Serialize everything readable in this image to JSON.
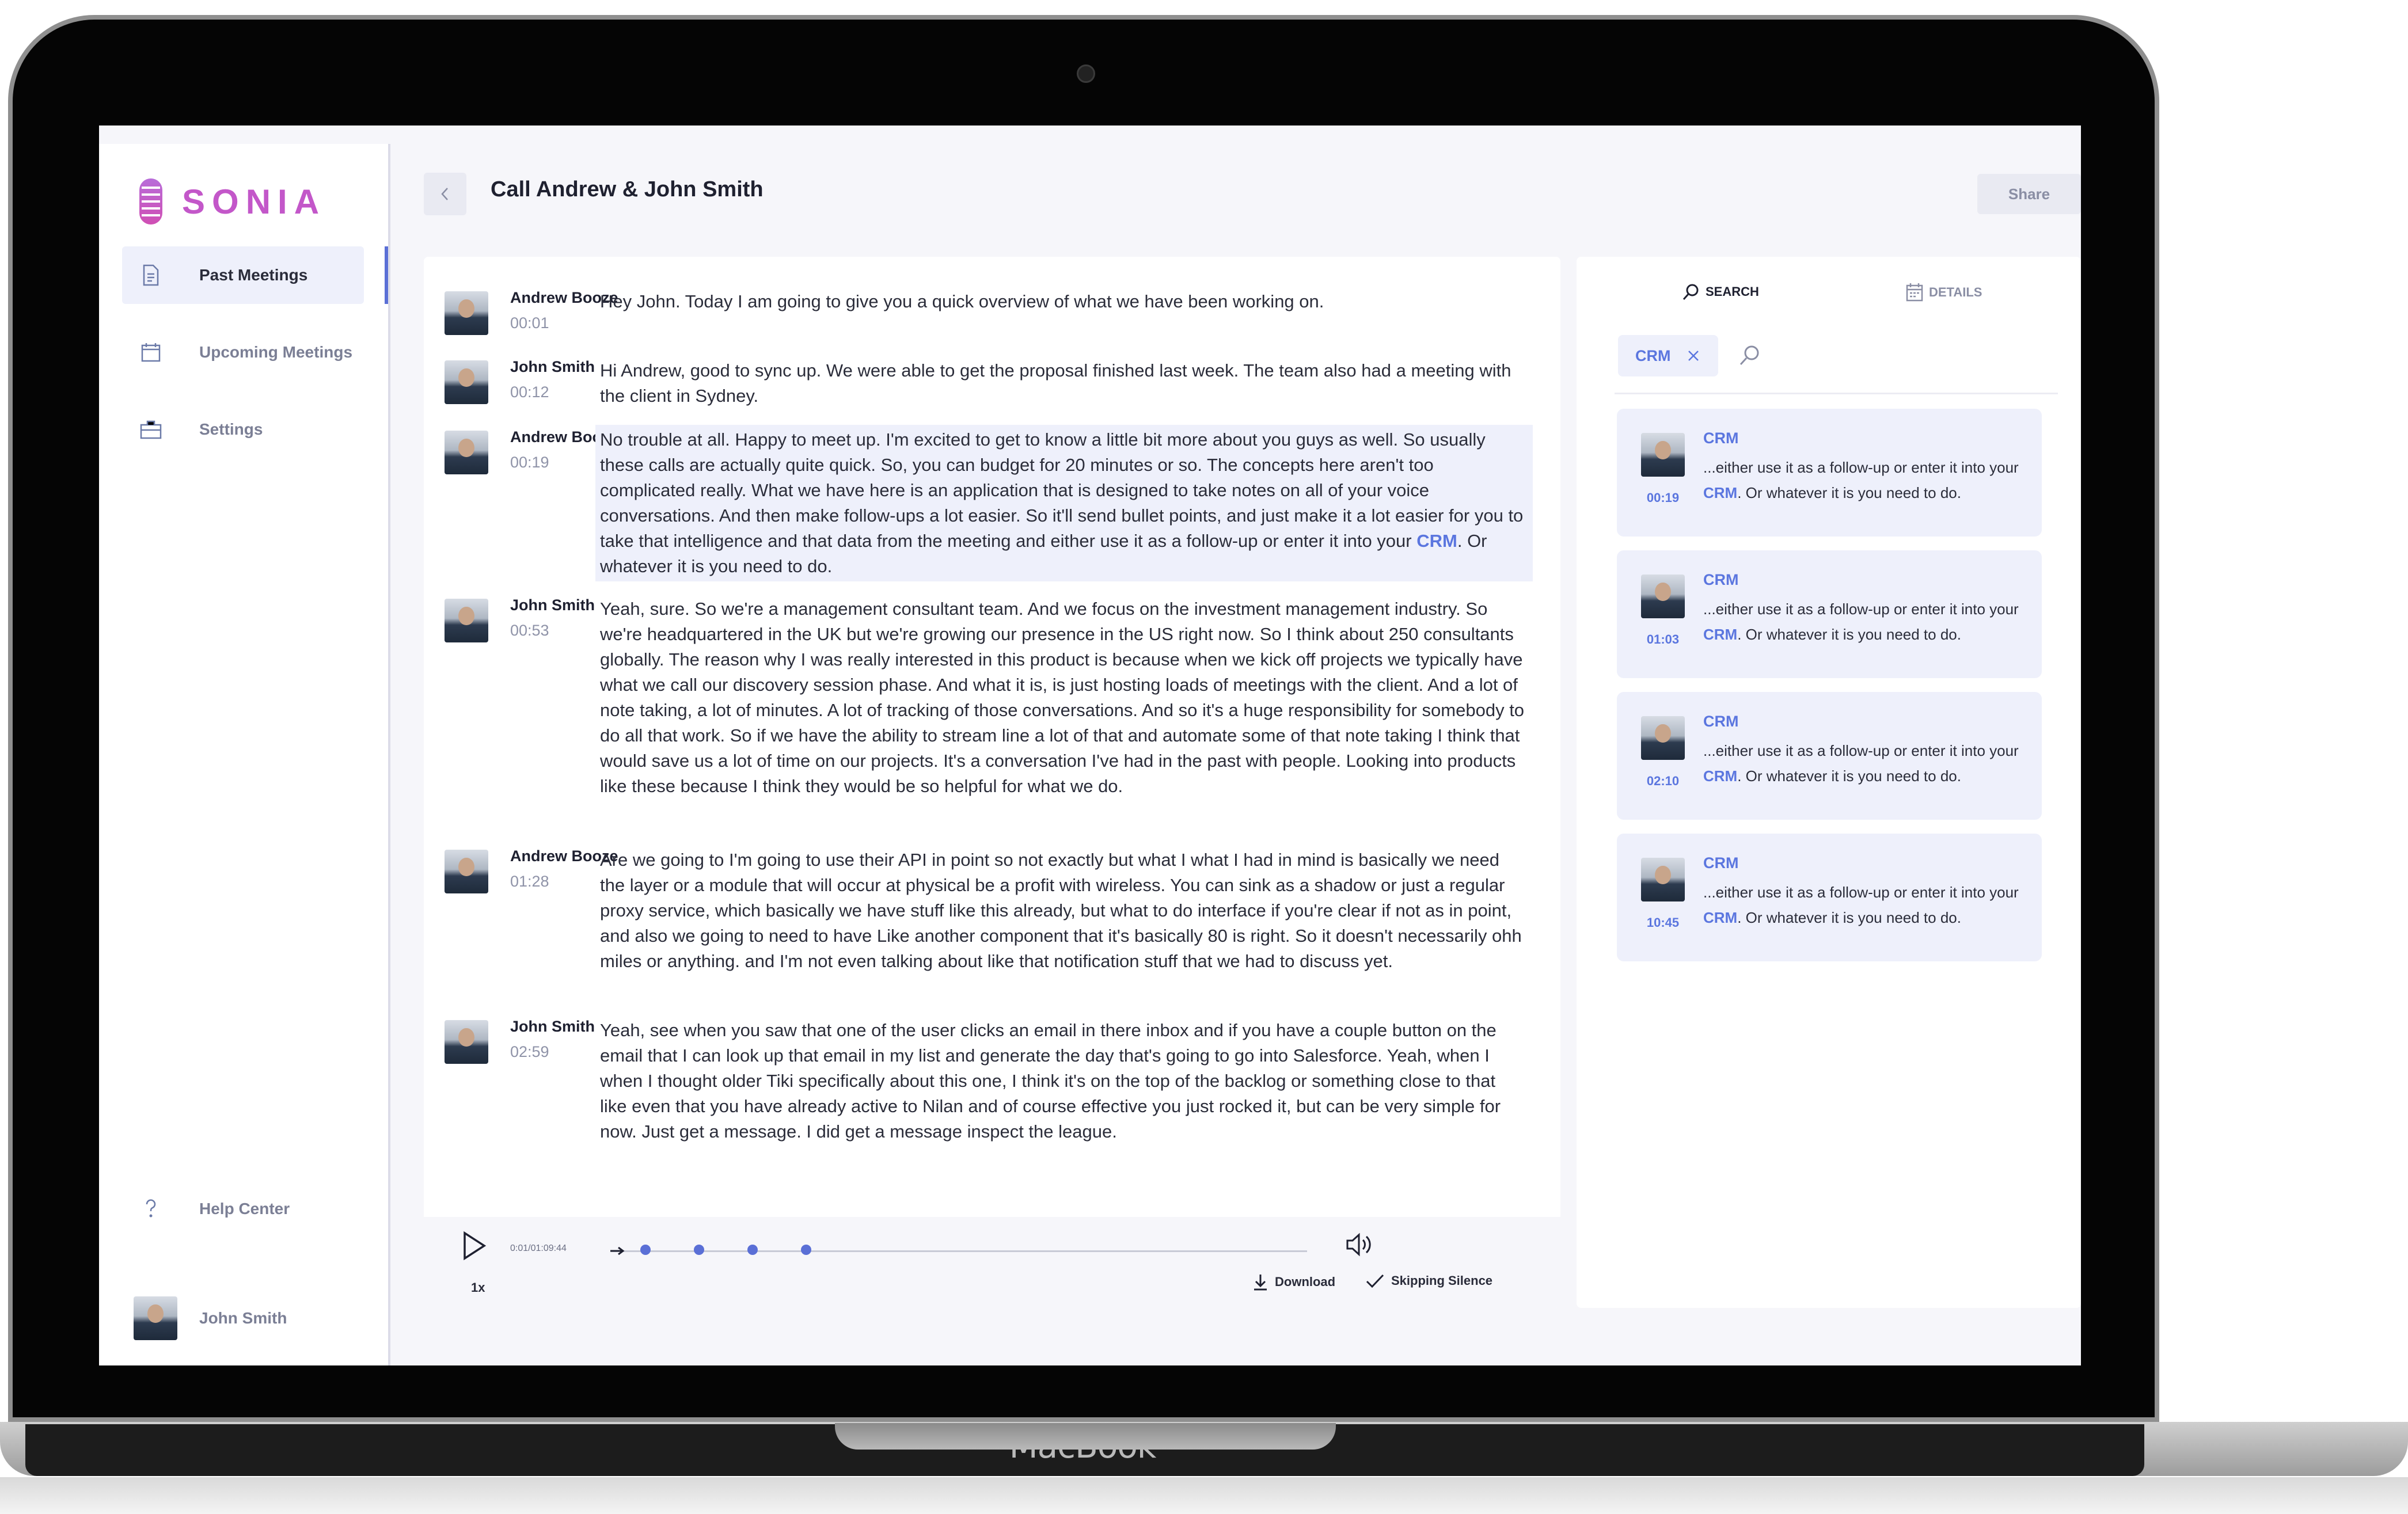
{
  "device": {
    "brand_label": "MacBook"
  },
  "sidebar": {
    "brand": "SONIA",
    "items": [
      {
        "label": "Past Meetings",
        "icon": "document-icon",
        "active": true
      },
      {
        "label": "Upcoming Meetings",
        "icon": "calendar-icon",
        "active": false
      },
      {
        "label": "Settings",
        "icon": "briefcase-icon",
        "active": false
      }
    ],
    "help": {
      "label": "Help Center",
      "icon": "question-icon"
    },
    "user": {
      "name": "John Smith"
    }
  },
  "header": {
    "title": "Call Andrew & John Smith",
    "share_label": "Share"
  },
  "transcript": [
    {
      "speaker": "Andrew Booze",
      "time": "00:01",
      "text": "Hey John. Today I am going to give you a quick overview of what we have been working on."
    },
    {
      "speaker": "John Smith",
      "time": "00:12",
      "text": "Hi Andrew, good to sync up. We were able to get the proposal finished last week. The team also had a meeting with the client in Sydney."
    },
    {
      "speaker": "Andrew Booze",
      "time": "00:19",
      "text_before": "No trouble at all. Happy to meet up. I'm excited to get to know a little bit more about you guys as well. So usually these calls are actually quite quick. So, you can budget for 20 minutes or so. The concepts here aren't too complicated really. What we have here is an application that is designed to take notes on all of your voice conversations. And then make follow-ups a lot easier. So it'll send bullet points, and just make it a lot easier for you to take that intelligence and that data from the meeting and either use it as a follow-up or enter it into your ",
      "keyword": "CRM",
      "text_after": ". Or whatever it is you need to do.",
      "highlighted": true
    },
    {
      "speaker": "John Smith",
      "time": "00:53",
      "text": "Yeah, sure. So we're a management consultant team. And we focus on the investment management industry. So we're headquartered in the UK but we're growing our presence in the US right now. So I think about 250 consultants globally. The reason why I was really interested in this product is because when we kick off projects we typically have what we call our discovery session phase. And what it is, is just hosting loads of meetings with the client. And a lot of note taking, a lot of minutes. A lot of tracking of those conversations. And so it's a huge responsibility for somebody to do all that work. So if we have the ability to stream line a lot of that and automate some of that note taking I think that would save us a lot of time on our projects. It's a conversation I've had in the past with people. Looking into products like these because I think they would be so helpful for what we do."
    },
    {
      "speaker": "Andrew Booze",
      "time": "01:28",
      "text": "Are we going to I'm going to use their API in point so not exactly but what I what I had in mind is basically we need the layer or a module that will occur at physical be a profit with wireless. You can sink as a shadow or just a regular proxy service, which basically we have stuff like this already, but what to do interface if you're clear if not as in point, and also we going to need to have Like another component that it's basically 80 is right. So it doesn't necessarily ohh miles or anything. and I'm not even talking about like that notification stuff that we had to discuss yet."
    },
    {
      "speaker": "John Smith",
      "time": "02:59",
      "text": "Yeah, see when you saw that one of the user clicks an email in there inbox and if you have a couple button on the email that I can look up that email in my list and generate the day that's going to go into Salesforce. Yeah, when I when I thought older Tiki specifically about this one, I think it's on the top of the backlog or something close to that like even that you have already active to Nilan and of course effective you just rocked it, but can be very simple for now. Just get a message. I did get a message inspect the league."
    }
  ],
  "player": {
    "speed": "1x",
    "timestamp": "0:01/01:09:44",
    "markers_fraction": [
      0.05,
      0.127,
      0.204,
      0.281
    ],
    "download_label": "Download",
    "skip_label": "Skipping Silence"
  },
  "right_panel": {
    "tabs": [
      {
        "label": "SEARCH",
        "icon": "search-icon"
      },
      {
        "label": "DETAILS",
        "icon": "calendar-icon"
      }
    ],
    "chip": "CRM",
    "results": [
      {
        "time": "00:19",
        "title": "CRM",
        "text_before": "...either use it as a follow-up or enter it into your ",
        "keyword": "CRM",
        "text_after": ". Or whatever it is you need to do."
      },
      {
        "time": "01:03",
        "title": "CRM",
        "text_before": "...either use it as a follow-up or enter it into your ",
        "keyword": "CRM",
        "text_after": ". Or whatever it is you need to do."
      },
      {
        "time": "02:10",
        "title": "CRM",
        "text_before": "...either use it as a follow-up or enter it into your ",
        "keyword": "CRM",
        "text_after": ". Or whatever it is you need to do."
      },
      {
        "time": "10:45",
        "title": "CRM",
        "text_before": "...either use it as a follow-up or enter it into your ",
        "keyword": "CRM",
        "text_after": ". Or whatever it is you need to do."
      }
    ]
  },
  "colors": {
    "accent": "#5b76df",
    "brand": "#c357c9",
    "highlight_bg": "#eef0fb"
  }
}
